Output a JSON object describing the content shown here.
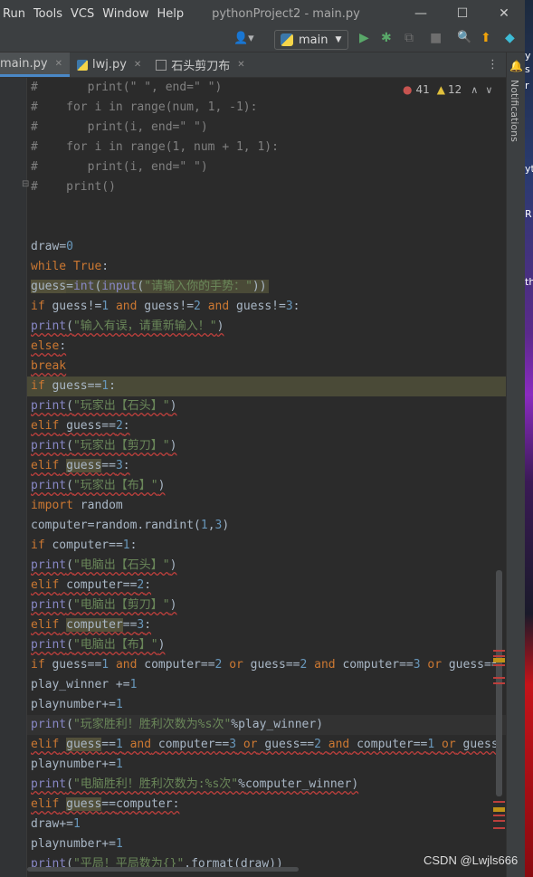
{
  "window": {
    "menu": [
      "Run",
      "Tools",
      "VCS",
      "Window",
      "Help"
    ],
    "title": "pythonProject2 - main.py",
    "minimize": "—",
    "maximize": "☐",
    "close": "✕"
  },
  "toolbar": {
    "user_icon": "👤▾",
    "run_config": "main",
    "run_icon": "▶",
    "debug_icon": "✱",
    "coverage_icon": "⧉",
    "stop_icon": "■",
    "search_icon": "🔍",
    "update_icon": "⬆",
    "plugin_icon": "◆"
  },
  "tabs": [
    {
      "label": "main.py",
      "active": true
    },
    {
      "label": "lwj.py",
      "active": false
    },
    {
      "label": "石头剪刀布",
      "active": false
    }
  ],
  "tabs_more": "⋮",
  "right_strip": {
    "label": "Notifications",
    "icon": "🔔"
  },
  "inspection": {
    "errors": "41",
    "warnings": "12",
    "up": "∧",
    "down": "∨"
  },
  "desktop_fragments": [
    "y",
    "s",
    "r",
    "yt",
    "R",
    "th"
  ],
  "watermark": "CSDN @Lwjls666",
  "code_lines": [
    "#       print(\" \", end=\" \")",
    "#    for i in range(num, 1, -1):",
    "#       print(i, end=\" \")",
    "#    for i in range(1, num + 1, 1):",
    "#       print(i, end=\" \")",
    "#    print()",
    "",
    "",
    "draw=0",
    "while True:",
    "guess=int(input(\"请输入你的手势：\"))",
    "if guess!=1 and guess!=2 and guess!=3:",
    "print(\"输入有误，请重新输入！\")",
    "else:",
    "break",
    "if guess==1:",
    "print(\"玩家出【石头】\")",
    "elif guess==2:",
    "print(\"玩家出【剪刀】\")",
    "elif guess==3:",
    "print(\"玩家出【布】\")",
    "import random",
    "computer=random.randint(1,3)",
    "if computer==1:",
    "print(\"电脑出【石头】\")",
    "elif computer==2:",
    "print(\"电脑出【剪刀】\")",
    "elif computer==3:",
    "print(\"电脑出【布】\")",
    "if guess==1 and computer==2 or guess==2 and computer==3 or guess==",
    "play_winner +=1",
    "playnumber+=1",
    "print(\"玩家胜利！胜利次数为%s次\"%play_winner)",
    "elif guess==1 and computer==3 or guess==2 and computer==1 or guess",
    "playnumber+=1",
    "print(\"电脑胜利！胜利次数为:%s次\"%computer_winner)",
    "elif guess==computer:",
    "draw+=1",
    "playnumber+=1",
    "print(\"平局！平局数为{}\".format(draw))"
  ]
}
